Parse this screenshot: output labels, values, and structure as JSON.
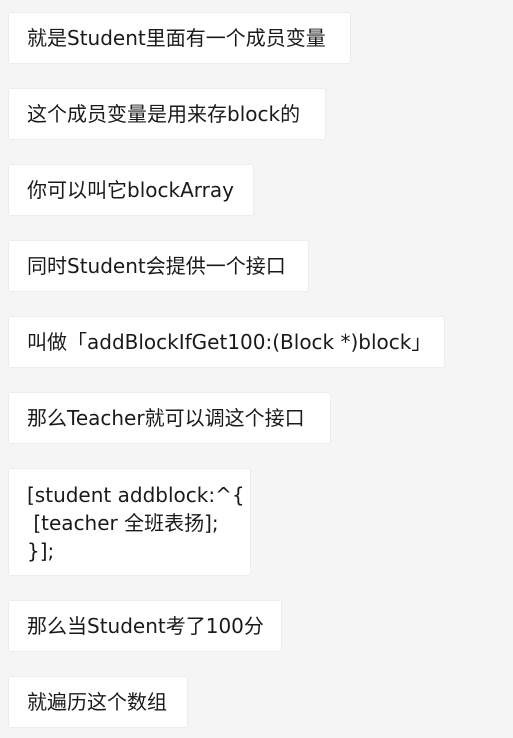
{
  "messages": [
    "就是Student里面有一个成员变量",
    "这个成员变量是用来存block的",
    "你可以叫它blockArray",
    "同时Student会提供一个接口",
    "叫做「addBlockIfGet100:(Block *)block」",
    "那么Teacher就可以调这个接口",
    "[student addblock:^{\n [teacher 全班表扬];\n}];",
    "那么当Student考了100分",
    "就遍历这个数组"
  ]
}
